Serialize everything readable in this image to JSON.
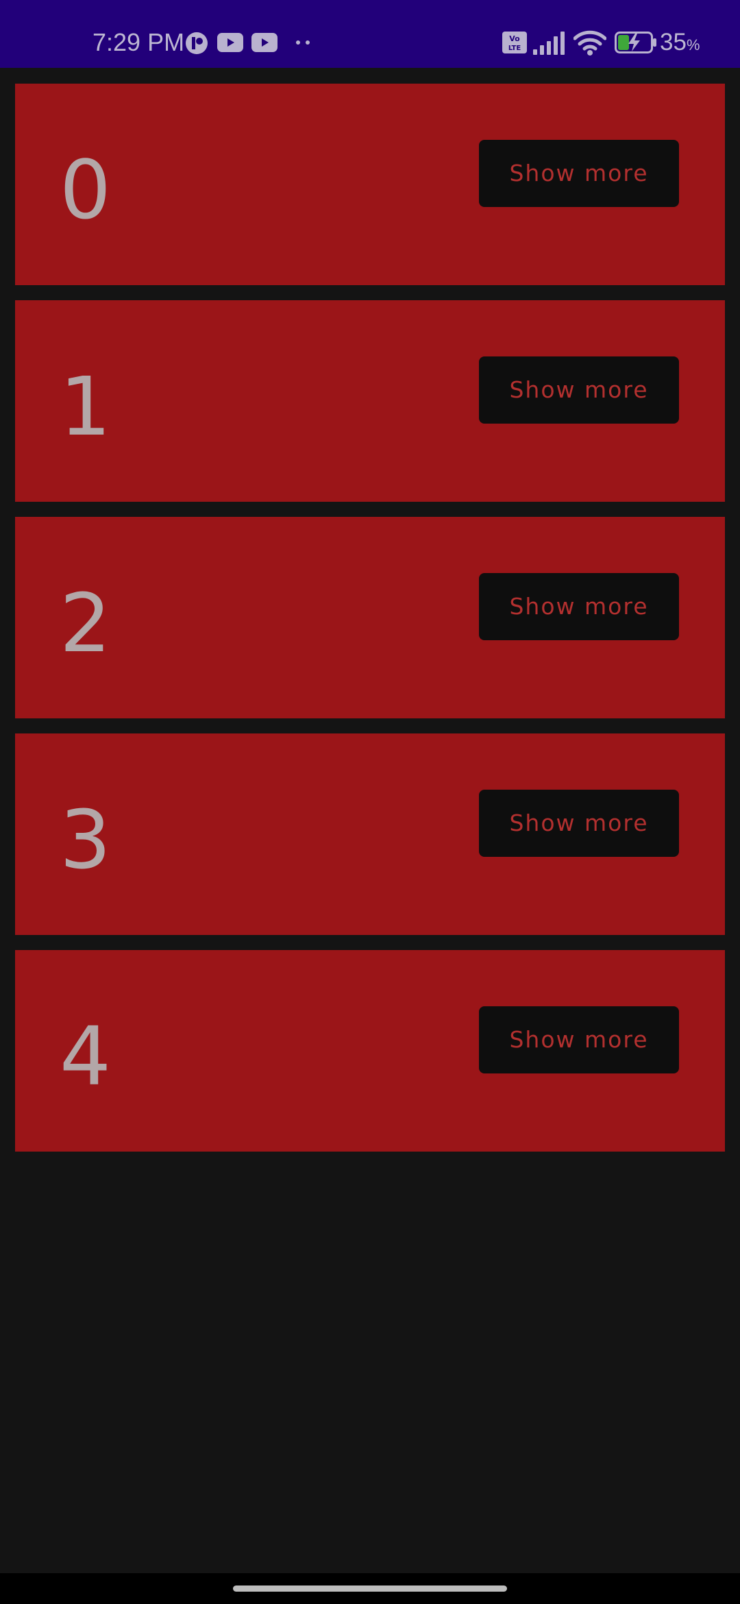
{
  "status_bar": {
    "time": "7:29 PM",
    "battery_percent": "35",
    "battery_percent_sign": "%",
    "battery_level": 0.35,
    "charging": true,
    "icons": [
      "notification-app-icon",
      "youtube-icon",
      "youtube-icon",
      "more-notifications-dots-icon",
      "volte-icon",
      "signal-icon",
      "wifi-icon",
      "battery-charging-icon"
    ],
    "colors": {
      "background": "#22007a",
      "battery_fill": "#3fa83a"
    }
  },
  "list": {
    "items": [
      {
        "number": "0",
        "button_label": "Show more"
      },
      {
        "number": "1",
        "button_label": "Show more"
      },
      {
        "number": "2",
        "button_label": "Show more"
      },
      {
        "number": "3",
        "button_label": "Show more"
      },
      {
        "number": "4",
        "button_label": "Show more"
      }
    ]
  },
  "colors": {
    "card_background": "#9b1518",
    "button_background": "#0e0e0e",
    "button_text": "#b3302f",
    "page_background": "#141414"
  }
}
